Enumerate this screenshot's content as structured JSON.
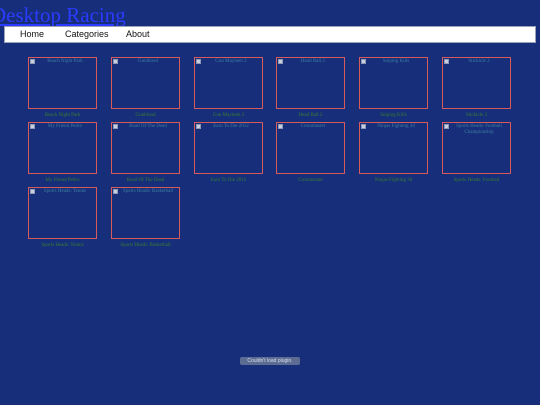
{
  "site": {
    "title": "Desktop Racing"
  },
  "nav": {
    "items": [
      "Home",
      "Categories",
      "About"
    ]
  },
  "games": [
    {
      "alt": "Beach Night Park",
      "caption": "Beach Night Park"
    },
    {
      "alt": "Gunblood",
      "caption": "Gunblood"
    },
    {
      "alt": "Gun Mayhem 2",
      "caption": "Gun Mayhem 2"
    },
    {
      "alt": "Head Ball 2",
      "caption": "Head Ball 2"
    },
    {
      "alt": "Sniping Kills",
      "caption": "Sniping Kills"
    },
    {
      "alt": "Stickicle 2",
      "caption": "Stickicle 2"
    },
    {
      "alt": "My Friend Pedro",
      "caption": "My Friend Pedro"
    },
    {
      "alt": "Road Of The Dead",
      "caption": "Road Of The Dead"
    },
    {
      "alt": "Earn To Die 2012",
      "caption": "Earn To Die 2012"
    },
    {
      "alt": "Crossmaster",
      "caption": "Crossmaster"
    },
    {
      "alt": "Ninjas Fighting 3d",
      "caption": "Ninjas Fighting 3d"
    },
    {
      "alt": "Sports Heads: Football Championship",
      "caption": "Sports Heads: Football"
    },
    {
      "alt": "Sports Heads: Tennis",
      "caption": "Sports Heads: Tennis"
    },
    {
      "alt": "Sports Heads: Basketball",
      "caption": "Sports Heads: Basketball"
    }
  ],
  "plugin_message": "Couldn't load plugin."
}
